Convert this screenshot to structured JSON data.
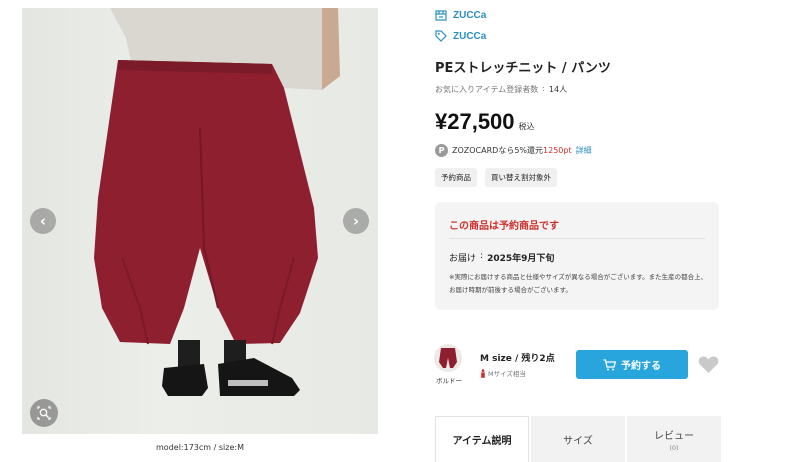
{
  "gallery": {
    "caption": "model:173cm / size:M",
    "prev_icon": "chevron-left-icon",
    "next_icon": "chevron-right-icon",
    "zoom_icon": "zoom-search-icon"
  },
  "brand": {
    "shop_icon": "shop-icon",
    "shop_name": "ZUCCa",
    "tag_icon": "tag-icon",
    "brand_name": "ZUCCa"
  },
  "product": {
    "name": "PEストレッチニット / パンツ",
    "favorites_label": "お気に入りアイテム登録者数",
    "favorites_sep": ":",
    "favorites_count": "14人",
    "price": "¥27,500",
    "tax_label": "税込",
    "points_badge": "P",
    "points_prefix": "ZOZOCARDなら5%還元",
    "points_value": "1250pt",
    "points_detail": "詳細",
    "tags": [
      "予約商品",
      "買い替え割対象外"
    ]
  },
  "notice": {
    "title": "この商品は予約商品です",
    "arrival_label": "お届け",
    "arrival_sep": ":",
    "arrival_date": "2025年9月下旬",
    "note": "※実際にお届けする商品と仕様やサイズが異なる場合がございます。また生産の都合上、お届け時期が前後する場合がございます。"
  },
  "sku": {
    "color": "ボルドー",
    "size_stock": "M size / 残り2点",
    "size_info": "Mサイズ相当",
    "reserve_label": "予約する",
    "cart_icon": "cart-icon",
    "favorite_icon": "heart-icon"
  },
  "tabs": [
    {
      "label": "アイテム説明",
      "sub": ""
    },
    {
      "label": "サイズ",
      "sub": ""
    },
    {
      "label": "レビュー",
      "sub": "(0)"
    }
  ],
  "colors": {
    "accent": "#27a5dc",
    "brand_link": "#2a8fbf",
    "notice_red": "#d0312d",
    "product_color": "#8e1f2f"
  }
}
